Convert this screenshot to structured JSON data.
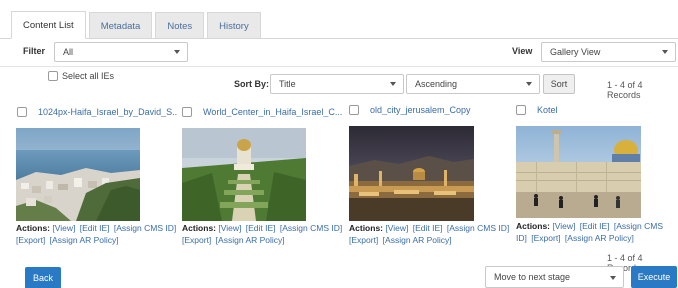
{
  "tabs": [
    {
      "label": "Content List"
    },
    {
      "label": "Metadata"
    },
    {
      "label": "Notes"
    },
    {
      "label": "History"
    }
  ],
  "filter": {
    "label": "Filter",
    "value": "All"
  },
  "view": {
    "label": "View",
    "value": "Gallery View"
  },
  "select_all_label": "Select all IEs",
  "sort": {
    "label": "Sort By:",
    "field": "Title",
    "order": "Ascending",
    "button": "Sort"
  },
  "records_top": "1 - 4 of 4 Records",
  "records_bottom": "1 - 4 of 4 Records",
  "actions": {
    "label": "Actions:",
    "view": "[View]",
    "edit": "[Edit IE]",
    "assign_cms": "[Assign CMS ID]",
    "export": "[Export]",
    "assign_ar": "[Assign AR Policy]"
  },
  "items": [
    {
      "title": "1024px-Haifa_Israel_by_David_S..."
    },
    {
      "title": "World_Center_in_Haifa_Israel_C..."
    },
    {
      "title": "old_city_jerusalem_Copy"
    },
    {
      "title": "Kotel"
    }
  ],
  "footer": {
    "back": "Back",
    "stage": "Move to next stage",
    "execute": "Execute"
  },
  "colors": {
    "accent": "#2a79c5",
    "link": "#3a6ea8"
  }
}
